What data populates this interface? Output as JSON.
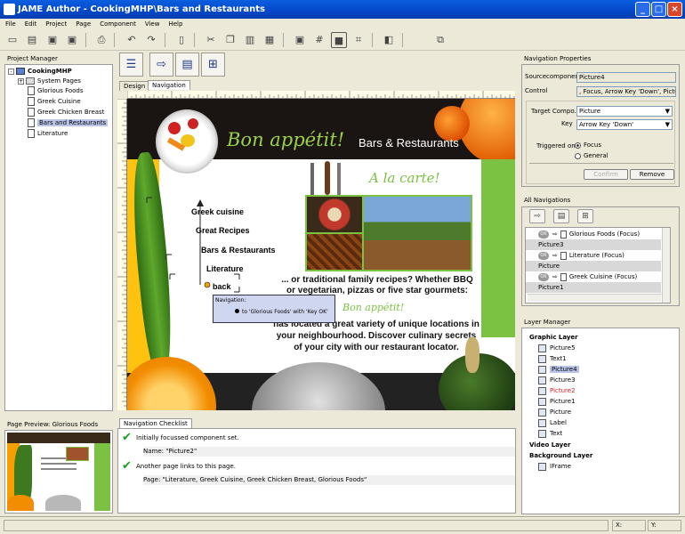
{
  "window": {
    "title": "JAME Author - CookingMHP\\Bars and Restaurants"
  },
  "menu": [
    "File",
    "Edit",
    "Project",
    "Page",
    "Component",
    "View",
    "Help"
  ],
  "project_manager": {
    "title": "Project Manager",
    "root": "CookingMHP",
    "items": [
      "System Pages",
      "Glorious Foods",
      "Greek Cuisine",
      "Greek Chicken Breast",
      "Bars and Restaurants",
      "Literature"
    ],
    "selected": "Bars and Restaurants"
  },
  "preview": {
    "title": "Page Preview: Glorious Foods"
  },
  "editor": {
    "tabs": [
      "Design",
      "Navigation"
    ],
    "active_tab": "Navigation"
  },
  "page": {
    "title_script": "Bon appétit!",
    "section_title": "Bars & Restaurants",
    "a_la_carte": "A la carte!",
    "menu_items": [
      "Greek cuisine",
      "Great Recipes",
      "Bars & Restaurants",
      "Literature",
      "back"
    ],
    "text_1": "... or traditional family recipes? Whether BBQ",
    "text_2": "or vegetarian, pizzas or five star gourmets:",
    "bon_small": "Bon appétit!",
    "text_3": "has located a great variety of unique locations in",
    "text_4": "your neighbourhood. Discover culinary secrets",
    "text_5": "of your city with our restaurant locator.",
    "tooltip_title": "Navigation:",
    "tooltip_text": "to 'Glorious Foods' with 'Key OK'"
  },
  "checklist": {
    "title": "Navigation Checklist",
    "items": [
      {
        "label": "Initially focussed component set.",
        "detail": "Name: \"Picture2\""
      },
      {
        "label": "Another page links to this page.",
        "detail": "Page: \"Literature, Greek Cuisine, Greek Chicken Breast, Glorious Foods\""
      }
    ]
  },
  "nav_props": {
    "title": "Navigation Properties",
    "source_label": "Sourcecomponent:",
    "source_value": "Picture4",
    "control_label": "Control",
    "control_value": ", Focus, Arrow Key 'Down', Picture",
    "target_label": "Target Compo...",
    "target_value": "Picture",
    "key_label": "Key",
    "key_value": "Arrow Key 'Down'",
    "triggered_label": "Triggered on:",
    "radio_focus": "Focus",
    "radio_general": "General",
    "confirm": "Confirm",
    "remove": "Remove"
  },
  "all_navs": {
    "title": "All Navigations",
    "rows": [
      {
        "type": "nav",
        "ok": "OK",
        "target": "Glorious Foods (Focus)"
      },
      {
        "type": "head",
        "text": "Picture3"
      },
      {
        "type": "nav",
        "ok": "OK",
        "target": "Literature (Focus)"
      },
      {
        "type": "head",
        "text": "Picture"
      },
      {
        "type": "nav",
        "ok": "OK",
        "target": "Greek Cuisine (Focus)"
      },
      {
        "type": "head",
        "text": "Picture1"
      }
    ]
  },
  "layers": {
    "title": "Layer Manager",
    "graphic": "Graphic Layer",
    "items": [
      "Picture5",
      "Text1",
      "Picture4",
      "Picture3",
      "Picture2",
      "Picture1",
      "Picture",
      "Label",
      "Text"
    ],
    "selected": "Picture4",
    "highlight": "Picture2",
    "video": "Video Layer",
    "background": "Background Layer",
    "bg_items": [
      "IFrame"
    ]
  },
  "status": {
    "x_label": "X:",
    "y_label": "Y:"
  },
  "colors": {
    "accent_green": "#7bc142",
    "orange": "#f5a000",
    "title_blue": "#0547c8",
    "selection": "#b9c4e8"
  }
}
